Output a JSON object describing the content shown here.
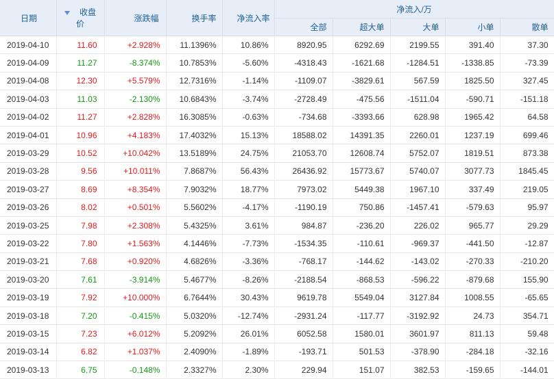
{
  "header": {
    "date": "日期",
    "close": "收盘价",
    "change": "涨跌幅",
    "turnover": "换手率",
    "net_rate": "净流入率",
    "net_group": "净流入/万",
    "all": "全部",
    "xl": "超大单",
    "large": "大单",
    "small": "小单",
    "retail": "散单",
    "sort_icon": "sort-down-arrow"
  },
  "colors": {
    "up": "#e31a1a",
    "down": "#119911",
    "header_bg": "#e7eef8",
    "header_text": "#1f5f99"
  },
  "rows": [
    {
      "date": "2019-04-10",
      "close": "11.60",
      "change": "+2.928%",
      "turnover": "11.1396%",
      "rate": "10.86%",
      "all": "8920.95",
      "xl": "6292.69",
      "large": "2199.55",
      "small": "391.40",
      "retail": "37.30",
      "dir": "up"
    },
    {
      "date": "2019-04-09",
      "close": "11.27",
      "change": "-8.374%",
      "turnover": "10.7853%",
      "rate": "-5.60%",
      "all": "-4318.43",
      "xl": "-1621.68",
      "large": "-1284.51",
      "small": "-1338.85",
      "retail": "-73.39",
      "dir": "down"
    },
    {
      "date": "2019-04-08",
      "close": "12.30",
      "change": "+5.579%",
      "turnover": "12.7316%",
      "rate": "-1.14%",
      "all": "-1109.07",
      "xl": "-3829.61",
      "large": "567.59",
      "small": "1825.50",
      "retail": "327.45",
      "dir": "up"
    },
    {
      "date": "2019-04-03",
      "close": "11.03",
      "change": "-2.130%",
      "turnover": "10.6843%",
      "rate": "-3.74%",
      "all": "-2728.49",
      "xl": "-475.56",
      "large": "-1511.04",
      "small": "-590.71",
      "retail": "-151.18",
      "dir": "down"
    },
    {
      "date": "2019-04-02",
      "close": "11.27",
      "change": "+2.828%",
      "turnover": "16.3085%",
      "rate": "-0.63%",
      "all": "-734.68",
      "xl": "-3393.66",
      "large": "628.98",
      "small": "1965.42",
      "retail": "64.58",
      "dir": "up"
    },
    {
      "date": "2019-04-01",
      "close": "10.96",
      "change": "+4.183%",
      "turnover": "17.4032%",
      "rate": "15.13%",
      "all": "18588.02",
      "xl": "14391.35",
      "large": "2260.01",
      "small": "1237.19",
      "retail": "699.46",
      "dir": "up"
    },
    {
      "date": "2019-03-29",
      "close": "10.52",
      "change": "+10.042%",
      "turnover": "13.5189%",
      "rate": "24.75%",
      "all": "21053.70",
      "xl": "12608.74",
      "large": "5752.07",
      "small": "1819.51",
      "retail": "873.38",
      "dir": "up"
    },
    {
      "date": "2019-03-28",
      "close": "9.56",
      "change": "+10.011%",
      "turnover": "7.8687%",
      "rate": "56.43%",
      "all": "26436.92",
      "xl": "15773.67",
      "large": "5740.07",
      "small": "3077.73",
      "retail": "1845.45",
      "dir": "up"
    },
    {
      "date": "2019-03-27",
      "close": "8.69",
      "change": "+8.354%",
      "turnover": "7.9032%",
      "rate": "18.77%",
      "all": "7973.02",
      "xl": "5449.38",
      "large": "1967.10",
      "small": "337.49",
      "retail": "219.05",
      "dir": "up"
    },
    {
      "date": "2019-03-26",
      "close": "8.02",
      "change": "+0.501%",
      "turnover": "5.5602%",
      "rate": "-4.17%",
      "all": "-1190.19",
      "xl": "750.86",
      "large": "-1457.41",
      "small": "-579.63",
      "retail": "95.97",
      "dir": "up"
    },
    {
      "date": "2019-03-25",
      "close": "7.98",
      "change": "+2.308%",
      "turnover": "5.4325%",
      "rate": "3.61%",
      "all": "984.87",
      "xl": "-236.20",
      "large": "226.02",
      "small": "965.77",
      "retail": "29.29",
      "dir": "up"
    },
    {
      "date": "2019-03-22",
      "close": "7.80",
      "change": "+1.563%",
      "turnover": "4.1446%",
      "rate": "-7.73%",
      "all": "-1534.35",
      "xl": "-110.61",
      "large": "-969.37",
      "small": "-441.50",
      "retail": "-12.87",
      "dir": "up"
    },
    {
      "date": "2019-03-21",
      "close": "7.68",
      "change": "+0.920%",
      "turnover": "4.6826%",
      "rate": "-3.36%",
      "all": "-768.17",
      "xl": "-144.62",
      "large": "-143.02",
      "small": "-270.33",
      "retail": "-210.20",
      "dir": "up"
    },
    {
      "date": "2019-03-20",
      "close": "7.61",
      "change": "-3.914%",
      "turnover": "5.4677%",
      "rate": "-8.26%",
      "all": "-2188.54",
      "xl": "-868.53",
      "large": "-596.22",
      "small": "-879.68",
      "retail": "155.90",
      "dir": "down"
    },
    {
      "date": "2019-03-19",
      "close": "7.92",
      "change": "+10.000%",
      "turnover": "6.7644%",
      "rate": "30.43%",
      "all": "9619.78",
      "xl": "5549.04",
      "large": "3127.84",
      "small": "1008.55",
      "retail": "-65.65",
      "dir": "up"
    },
    {
      "date": "2019-03-18",
      "close": "7.20",
      "change": "-0.415%",
      "turnover": "5.0320%",
      "rate": "-12.74%",
      "all": "-2931.24",
      "xl": "-117.77",
      "large": "-3192.92",
      "small": "24.73",
      "retail": "354.71",
      "dir": "down"
    },
    {
      "date": "2019-03-15",
      "close": "7.23",
      "change": "+6.012%",
      "turnover": "5.2092%",
      "rate": "26.01%",
      "all": "6052.58",
      "xl": "1580.01",
      "large": "3601.97",
      "small": "811.13",
      "retail": "59.48",
      "dir": "up"
    },
    {
      "date": "2019-03-14",
      "close": "6.82",
      "change": "+1.037%",
      "turnover": "2.4090%",
      "rate": "-1.89%",
      "all": "-193.71",
      "xl": "501.53",
      "large": "-378.90",
      "small": "-284.18",
      "retail": "-32.16",
      "dir": "up"
    },
    {
      "date": "2019-03-13",
      "close": "6.75",
      "change": "-0.148%",
      "turnover": "2.3327%",
      "rate": "2.30%",
      "all": "229.94",
      "xl": "151.07",
      "large": "382.53",
      "small": "-159.65",
      "retail": "-144.01",
      "dir": "down"
    }
  ]
}
